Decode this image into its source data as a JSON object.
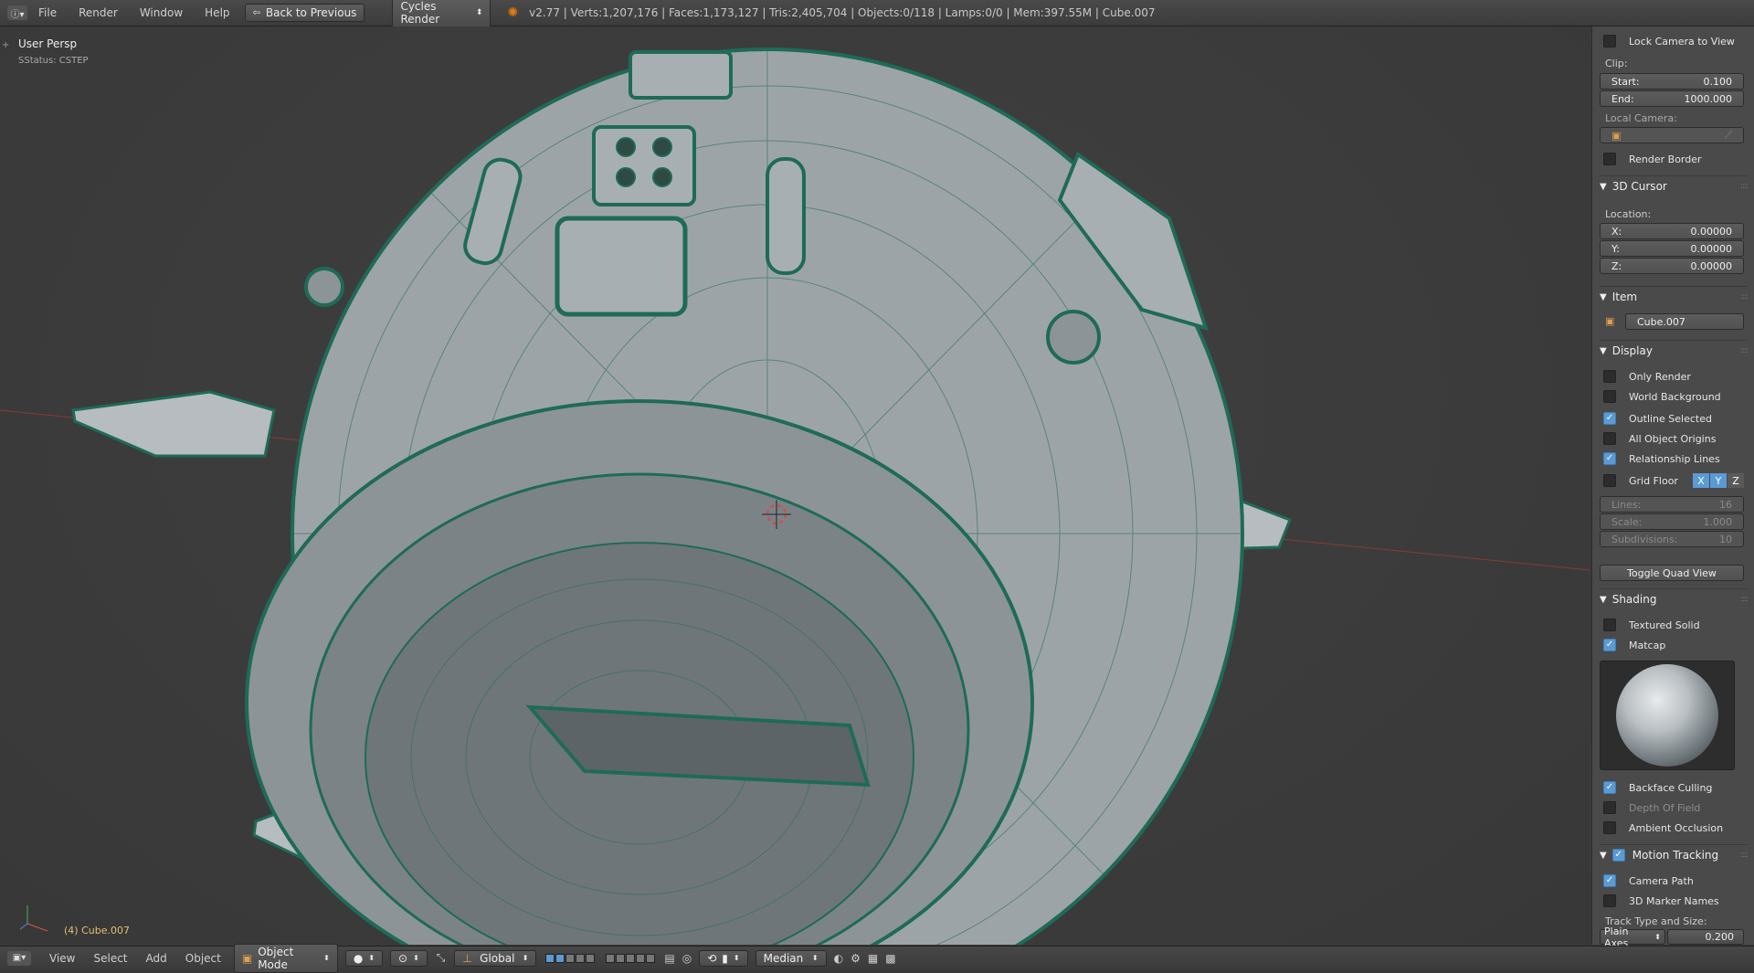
{
  "topbar": {
    "menus": [
      "File",
      "Render",
      "Window",
      "Help"
    ],
    "back_button": "Back to Previous",
    "render_engine": "Cycles Render",
    "info": "v2.77 | Verts:1,207,176 | Faces:1,173,127 | Tris:2,405,704 | Objects:0/118 | Lamps:0/0 | Mem:397.55M | Cube.007"
  },
  "viewport": {
    "view_name": "User Persp",
    "status": "SStatus: CSTEP",
    "object_label": "(4) Cube.007"
  },
  "sidebar": {
    "lock_camera": {
      "label": "Lock Camera to View",
      "checked": false
    },
    "clip_label": "Clip:",
    "clip_start": {
      "label": "Start:",
      "value": "0.100"
    },
    "clip_end": {
      "label": "End:",
      "value": "1000.000"
    },
    "local_camera_label": "Local Camera:",
    "render_border": {
      "label": "Render Border",
      "checked": false
    },
    "cursor_header": "3D Cursor",
    "location_label": "Location:",
    "cursor_x": {
      "label": "X:",
      "value": "0.00000"
    },
    "cursor_y": {
      "label": "Y:",
      "value": "0.00000"
    },
    "cursor_z": {
      "label": "Z:",
      "value": "0.00000"
    },
    "item_header": "Item",
    "item_name": "Cube.007",
    "display_header": "Display",
    "only_render": {
      "label": "Only Render",
      "checked": false
    },
    "world_background": {
      "label": "World Background",
      "checked": false
    },
    "outline_selected": {
      "label": "Outline Selected",
      "checked": true
    },
    "all_origins": {
      "label": "All Object Origins",
      "checked": false
    },
    "relationship_lines": {
      "label": "Relationship Lines",
      "checked": true
    },
    "grid_floor": {
      "label": "Grid Floor",
      "checked": false
    },
    "axes": [
      "X",
      "Y",
      "Z"
    ],
    "lines": {
      "label": "Lines:",
      "value": "16"
    },
    "scale": {
      "label": "Scale:",
      "value": "1.000"
    },
    "subdivisions": {
      "label": "Subdivisions:",
      "value": "10"
    },
    "toggle_quad": "Toggle Quad View",
    "shading_header": "Shading",
    "textured_solid": {
      "label": "Textured Solid",
      "checked": false
    },
    "matcap": {
      "label": "Matcap",
      "checked": true
    },
    "backface_culling": {
      "label": "Backface Culling",
      "checked": true
    },
    "depth_of_field": {
      "label": "Depth Of Field",
      "checked": false
    },
    "ambient_occlusion": {
      "label": "Ambient Occlusion",
      "checked": false
    },
    "motion_header": "Motion Tracking",
    "camera_path": {
      "label": "Camera Path",
      "checked": true
    },
    "marker_names": {
      "label": "3D Marker Names",
      "checked": false
    },
    "track_label": "Track Type and Size:",
    "track_type": "Plain Axes",
    "track_size": "0.200"
  },
  "statusbar": {
    "menus": [
      "View",
      "Select",
      "Add",
      "Object"
    ],
    "mode": "Object Mode",
    "orientation": "Global",
    "pivot": "Median"
  },
  "colors": {
    "accent": "#5b9bd5",
    "wire": "#1e6b57",
    "mesh": "#a9b0b4"
  }
}
